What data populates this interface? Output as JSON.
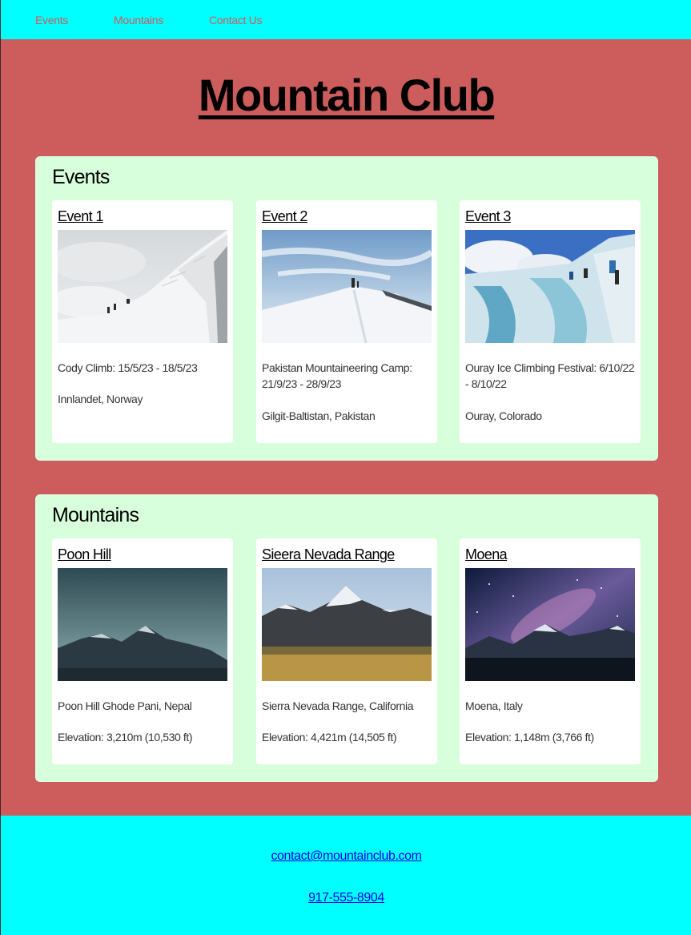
{
  "nav": {
    "items": [
      "Events",
      "Mountains",
      "Contact Us"
    ]
  },
  "title": "Mountain Club",
  "events": {
    "heading": "Events",
    "cards": [
      {
        "title": "Event 1",
        "line1": "Cody Climb: 15/5/23 - 18/5/23",
        "line2": "Innlandet, Norway"
      },
      {
        "title": "Event 2",
        "line1": "Pakistan Mountaineering Camp: 21/9/23 - 28/9/23",
        "line2": "Gilgit-Baltistan, Pakistan"
      },
      {
        "title": "Event 3",
        "line1": "Ouray Ice Climbing Festival: 6/10/22 - 8/10/22",
        "line2": "Ouray, Colorado"
      }
    ]
  },
  "mountains": {
    "heading": "Mountains",
    "cards": [
      {
        "title": "Poon Hill",
        "line1": "Poon Hill Ghode Pani, Nepal",
        "line2": "Elevation: 3,210m (10,530 ft)"
      },
      {
        "title": "Sieera Nevada Range",
        "line1": "Sierra Nevada Range, California",
        "line2": "Elevation: 4,421m (14,505 ft)"
      },
      {
        "title": "Moena",
        "line1": "Moena, Italy",
        "line2": "Elevation: 1,148m (3,766 ft)"
      }
    ]
  },
  "footer": {
    "email": "contact@mountainclub.com",
    "phone": "917-555-8904"
  },
  "colors": {
    "nav_bg": "#00ffff",
    "page_bg": "#cd5c5c",
    "section_bg": "#d8ffdb",
    "link": "#0000ee"
  }
}
